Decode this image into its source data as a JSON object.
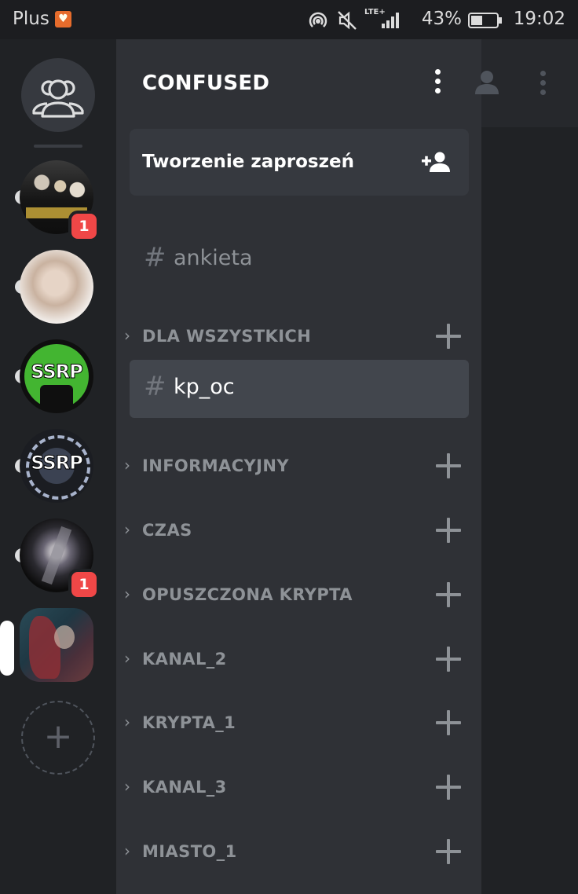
{
  "status_bar": {
    "carrier": "Plus",
    "network": "LTE+",
    "battery_percent": "43%",
    "time": "19:02"
  },
  "server_rail": {
    "servers": [
      {
        "name": "server-1",
        "badge": "1",
        "unread": true,
        "active": false
      },
      {
        "name": "server-2",
        "badge": "",
        "unread": true,
        "active": false
      },
      {
        "name": "server-3",
        "label": "SSRP",
        "badge": "",
        "unread": true,
        "active": false
      },
      {
        "name": "server-4",
        "label": "SSRP",
        "badge": "",
        "unread": true,
        "active": false
      },
      {
        "name": "server-5",
        "badge": "1",
        "unread": true,
        "active": false
      },
      {
        "name": "server-6",
        "badge": "",
        "unread": false,
        "active": true
      }
    ]
  },
  "drawer": {
    "guild_name": "CONFUSED",
    "invite_label": "Tworzenie zaproszeń",
    "top_channel": {
      "hash": "#",
      "name": "ankieta"
    },
    "selected_channel": {
      "hash": "#",
      "name": "kp_oc"
    },
    "categories": [
      {
        "name": "DLA WSZYSTKICH"
      },
      {
        "name": "INFORMACYJNY"
      },
      {
        "name": "CZAS"
      },
      {
        "name": "OPUSZCZONA KRYPTA"
      },
      {
        "name": "KANAL_2"
      },
      {
        "name": "KRYPTA_1"
      },
      {
        "name": "KANAL_3"
      },
      {
        "name": "MIASTO_1"
      }
    ]
  },
  "colors": {
    "rail_bg": "#202225",
    "drawer_bg": "#2f3136",
    "selected_channel_bg": "#42464d",
    "badge_red": "#f04747",
    "muted_text": "#8e9297"
  }
}
